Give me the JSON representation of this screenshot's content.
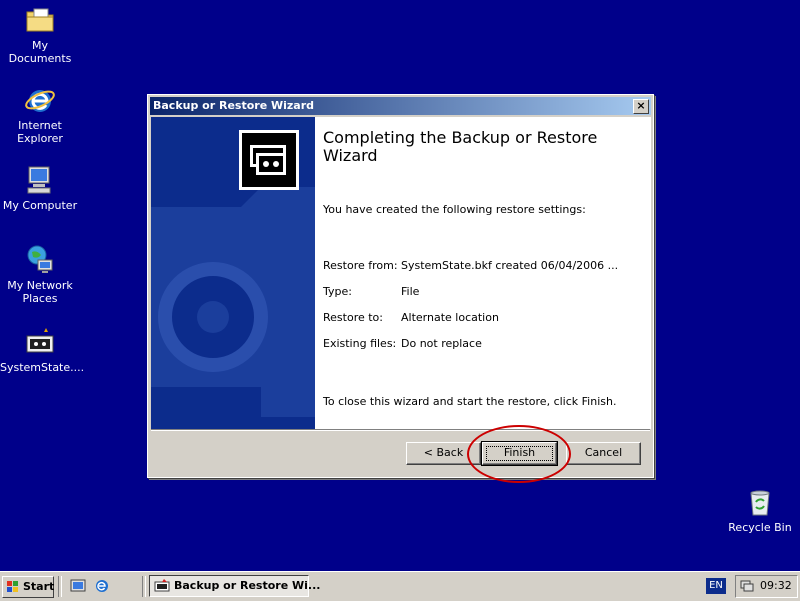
{
  "desktop": {
    "icons": [
      {
        "label": "My Documents"
      },
      {
        "label": "Internet Explorer"
      },
      {
        "label": "My Computer"
      },
      {
        "label": "My Network Places"
      },
      {
        "label": "SystemState...."
      },
      {
        "label": "Recycle Bin"
      }
    ]
  },
  "wizard": {
    "title": "Backup or Restore Wizard",
    "close": "×",
    "heading": "Completing the Backup or Restore Wizard",
    "intro": "You have created the following restore settings:",
    "settings": [
      {
        "key": "Restore from:",
        "value": "SystemState.bkf created 06/04/2006 ..."
      },
      {
        "key": "Type:",
        "value": "File"
      },
      {
        "key": "Restore to:",
        "value": "Alternate location"
      },
      {
        "key": "Existing files:",
        "value": "Do not replace"
      }
    ],
    "closing": "To close this wizard and start the restore, click Finish.",
    "buttons": {
      "back": "< Back",
      "finish": "Finish",
      "cancel": "Cancel"
    }
  },
  "taskbar": {
    "start": "Start",
    "task": "Backup or Restore Wi...",
    "lang": "EN",
    "clock": "09:32"
  },
  "colors": {
    "desktop": "#00008a",
    "titlebar": "#0a246a",
    "highlight": "#cc0000"
  }
}
